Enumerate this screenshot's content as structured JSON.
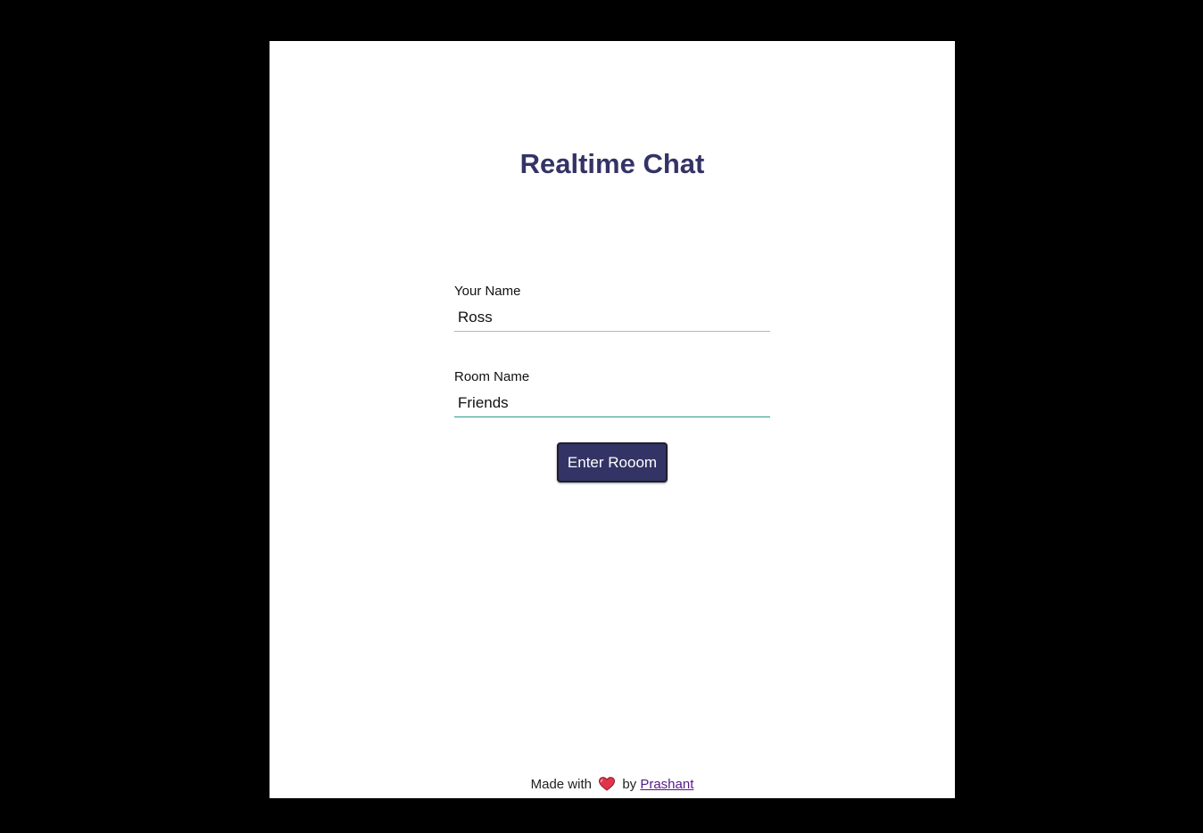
{
  "app": {
    "title": "Realtime Chat"
  },
  "form": {
    "name_label": "Your Name",
    "name_value": "Ross",
    "room_label": "Room Name",
    "room_value": "Friends",
    "submit_label": "Enter Rooom"
  },
  "footer": {
    "prefix": "Made with",
    "icon": "heart-icon",
    "by": "by",
    "author_link": "Prashant"
  },
  "colors": {
    "page_background": "#000000",
    "card_background": "#ffffff",
    "accent": "#333366",
    "focus_underline": "#2a9d8f",
    "heart": "#e0344b",
    "link": "#551a8b"
  }
}
